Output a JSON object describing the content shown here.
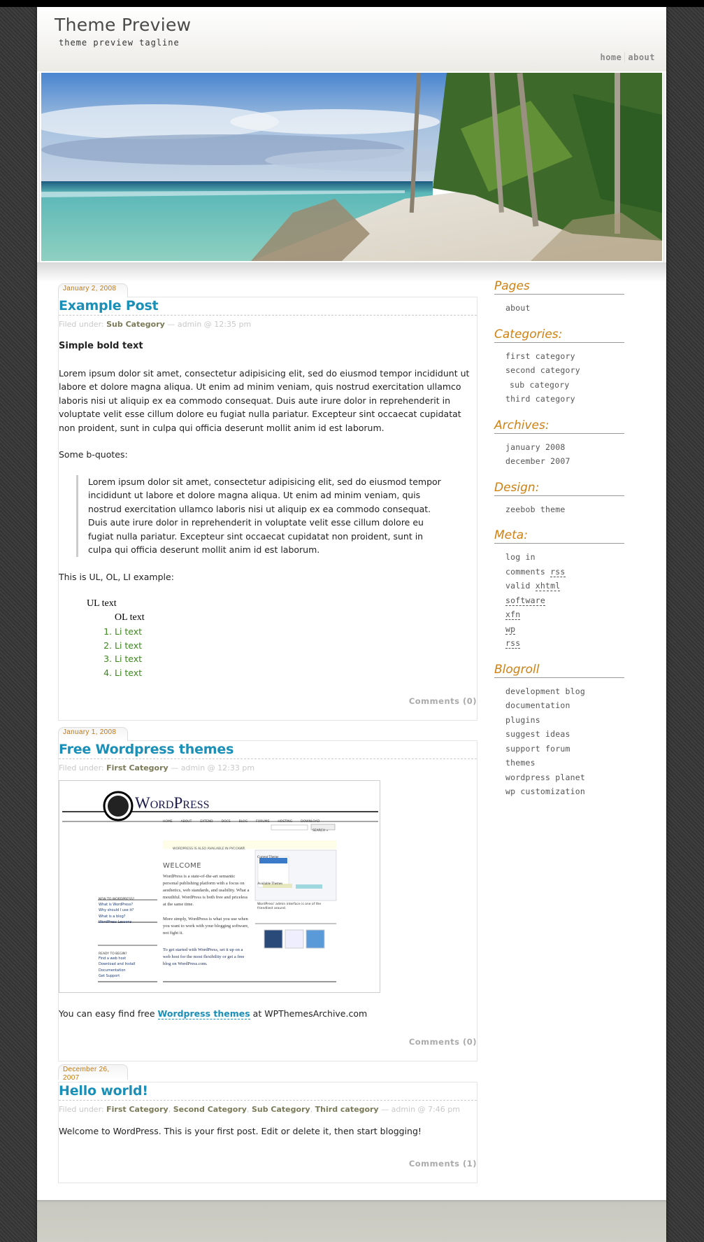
{
  "header": {
    "title": "Theme Preview",
    "tagline": "theme preview tagline",
    "nav": [
      {
        "label": "home"
      },
      {
        "label": "about"
      }
    ]
  },
  "banner": {
    "alt": "tropical beach with palm trees and driftwood"
  },
  "posts": [
    {
      "date": "January 2, 2008",
      "title": "Example Post",
      "meta_prefix": "Filed under:",
      "categories": [
        "Sub Category"
      ],
      "meta_suffix": "— admin @ 12:35 pm",
      "bold_text": "Simple bold text",
      "paragraph": "Lorem ipsum dolor sit amet, consectetur adipisicing elit, sed do eiusmod tempor incididunt ut labore et dolore magna aliqua. Ut enim ad minim veniam, quis nostrud exercitation ullamco laboris nisi ut aliquip ex ea commodo consequat. Duis aute irure dolor in reprehenderit in voluptate velit esse cillum dolore eu fugiat nulla pariatur. Excepteur sint occaecat cupidatat non proident, sunt in culpa qui officia deserunt mollit anim id est laborum.",
      "bquote_intro": "Some b-quotes:",
      "blockquote": "Lorem ipsum dolor sit amet, consectetur adipisicing elit, sed do eiusmod tempor incididunt ut labore et dolore magna aliqua. Ut enim ad minim veniam, quis nostrud exercitation ullamco laboris nisi ut aliquip ex ea commodo consequat. Duis aute irure dolor in reprehenderit in voluptate velit esse cillum dolore eu fugiat nulla pariatur. Excepteur sint occaecat cupidatat non proident, sunt in culpa qui officia deserunt mollit anim id est laborum.",
      "list_intro": "This is UL, OL, LI example:",
      "ul_text": "UL text",
      "ol_text": "OL text",
      "li_items": [
        "Li text",
        "Li text",
        "Li text",
        "Li text"
      ],
      "comments": "Comments (0)"
    },
    {
      "date": "January 1, 2008",
      "title": "Free Wordpress themes",
      "meta_prefix": "Filed under:",
      "categories": [
        "First Category"
      ],
      "meta_suffix": "— admin @ 12:33 pm",
      "screenshot": {
        "logo": "WordPress",
        "nav": [
          "HOME",
          "ABOUT",
          "EXTEND",
          "DOCS",
          "BLOG",
          "FORUMS",
          "HOSTING",
          "DOWNLOAD"
        ],
        "search_button": "SEARCH »",
        "notice": "WORDPRESS IS ALSO AVAILABLE IN РУССКИЙ.",
        "welcome": "WELCOME",
        "intro": "WordPress is a state-of-the-art semantic personal publishing platform with a focus on aesthetics, web standards, and usability. What a mouthful. WordPress is both free and priceless at the same time.",
        "simply": "More simply, WordPress is what you use when you want to work with your blogging software, not fight it.",
        "started": "To get started with WordPress, set it up on a web host for the most flexibility or get a free blog on WordPress.com.",
        "new_heading": "NEW TO WORDPRESS?",
        "new_links": [
          "What is WordPress?",
          "Why should I use it?",
          "What is a blog?",
          "WordPress Lessons"
        ],
        "ready_heading": "READY TO BEGIN?",
        "ready_links": [
          "Find a web host",
          "Download and Install",
          "Documentation",
          "Get Support"
        ],
        "current_theme": "Current Theme",
        "available_themes": "Available Themes",
        "caption": "WordPress' admin interface is one of the friendliest around."
      },
      "text_before": "You can easy find free",
      "link": "Wordpress themes",
      "text_after": "at WPThemesArchive.com",
      "comments": "Comments (0)"
    },
    {
      "date": "December 26, 2007",
      "title": "Hello world!",
      "meta_prefix": "Filed under:",
      "categories": [
        "First Category",
        "Second Category",
        "Sub Category",
        "Third category"
      ],
      "meta_suffix": "— admin @ 7:46 pm",
      "body": "Welcome to WordPress. This is your first post. Edit or delete it, then start blogging!",
      "comments": "Comments (1)"
    }
  ],
  "sidebar": {
    "pages": {
      "title": "Pages",
      "items": [
        "about"
      ]
    },
    "categories": {
      "title": "Categories:",
      "items": [
        "first category",
        "second category",
        "sub category",
        "third category"
      ]
    },
    "archives": {
      "title": "Archives:",
      "items": [
        "january 2008",
        "december 2007"
      ]
    },
    "design": {
      "title": "Design:",
      "items": [
        "zeebob theme"
      ]
    },
    "meta": {
      "title": "Meta:",
      "items": [
        {
          "text": "log in",
          "abbr": ""
        },
        {
          "text": "comments ",
          "abbr": "rss"
        },
        {
          "text": "valid ",
          "abbr": "xhtml"
        },
        {
          "text": "",
          "abbr": "software"
        },
        {
          "text": "",
          "abbr": "xfn"
        },
        {
          "text": "",
          "abbr": "wp"
        },
        {
          "text": "",
          "abbr": "rss"
        }
      ]
    },
    "blogroll": {
      "title": "Blogroll",
      "items": [
        "development blog",
        "documentation",
        "plugins",
        "suggest ideas",
        "support forum",
        "themes",
        "wordpress planet",
        "wp customization"
      ]
    }
  },
  "colors": {
    "post_title": "#1a8fb8",
    "date": "#c07810",
    "widget_title": "#d08010",
    "list_items": "#3a8a1a",
    "meta_category": "#7a7a58"
  }
}
